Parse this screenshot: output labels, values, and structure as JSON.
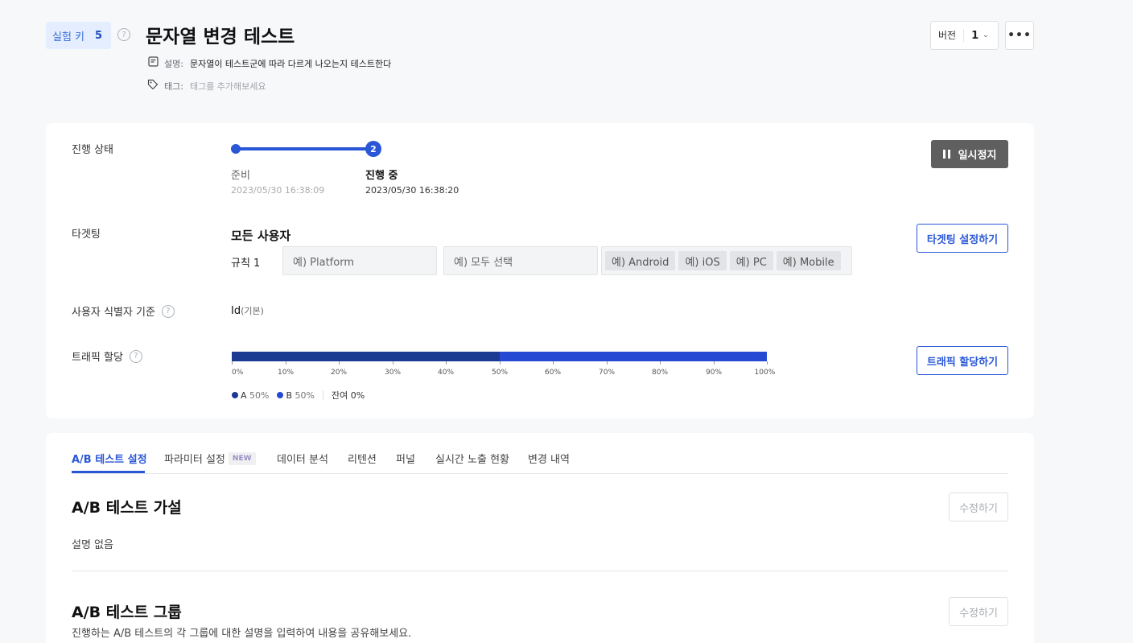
{
  "header": {
    "key_label": "실험 키",
    "key_value": "5",
    "help_glyph": "?",
    "title": "문자열 변경 테스트",
    "desc_label": "설명:",
    "desc_value": "문자열이 테스트군에 따라 다르게 나오는지 테스트한다",
    "tag_label": "태그:",
    "tag_placeholder": "태그를 추가해보세요",
    "version_label": "버전",
    "version_value": "1",
    "more_glyph": "•••"
  },
  "progress": {
    "label": "진행 상태",
    "steps": [
      {
        "name": "준비",
        "time": "2023/05/30 16:38:09"
      },
      {
        "name": "진행 중",
        "time": "2023/05/30 16:38:20",
        "number": "2"
      }
    ],
    "pause_label": "일시정지"
  },
  "targeting": {
    "label": "타겟팅",
    "audience": "모든 사용자",
    "rule_label": "규칙 1",
    "field1_placeholder": "예) Platform",
    "field2_placeholder": "예) 모두 선택",
    "chips": [
      "예) Android",
      "예) iOS",
      "예) PC",
      "예) Mobile"
    ],
    "button": "타겟팅 설정하기"
  },
  "identifier": {
    "label": "사용자 식별자 기준",
    "value": "Id",
    "value_suffix": "(기본)"
  },
  "traffic": {
    "label": "트래픽 할당",
    "ticks": [
      "0%",
      "10%",
      "20%",
      "30%",
      "40%",
      "50%",
      "60%",
      "70%",
      "80%",
      "90%",
      "100%"
    ],
    "groups": [
      {
        "name": "A",
        "percent": "50%",
        "share": 0.5,
        "color": "#1b3a91"
      },
      {
        "name": "B",
        "percent": "50%",
        "share": 0.5,
        "color": "#2649d4"
      }
    ],
    "remaining_label": "잔여",
    "remaining_value": "0%",
    "button": "트래픽 할당하기"
  },
  "tabs": {
    "items": [
      "A/B 테스트 설정",
      "파라미터 설정",
      "데이터 분석",
      "리텐션",
      "퍼널",
      "실시간 노출 현황",
      "변경 내역"
    ],
    "new_badge": "NEW",
    "active": 0
  },
  "hypothesis": {
    "title": "A/B 테스트 가설",
    "edit": "수정하기",
    "body": "설명 없음"
  },
  "groups_section": {
    "title": "A/B 테스트 그룹",
    "edit": "수정하기",
    "body": "진행하는 A/B 테스트의 각 그룹에 대한 설명을 입력하여 내용을 공유해보세요."
  },
  "colors": {
    "accent": "#2a57d6",
    "group_a": "#1b3a91",
    "group_b": "#2649d4"
  }
}
